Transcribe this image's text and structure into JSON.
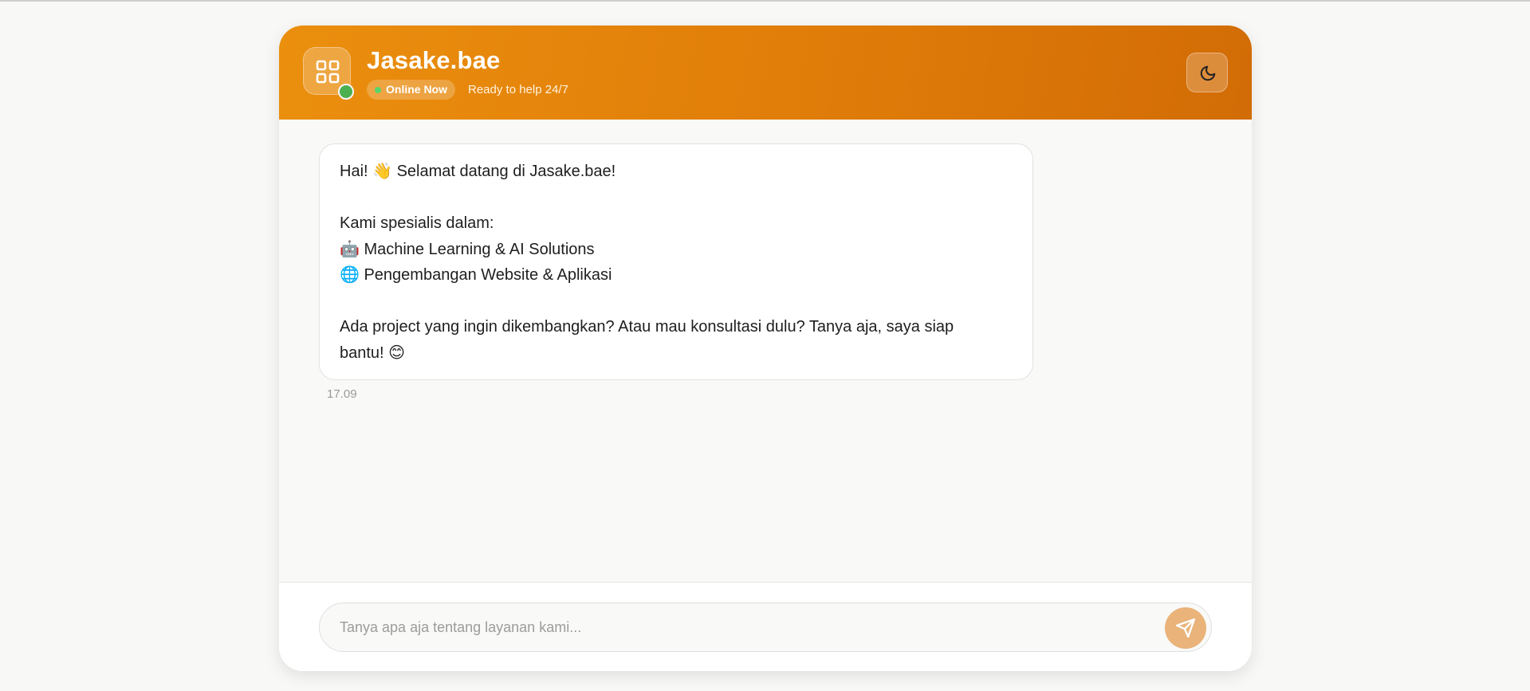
{
  "header": {
    "title": "Jasake.bae",
    "status_label": "Online Now",
    "status_subtext": "Ready to help 24/7",
    "logo_icon": "grid-icon",
    "theme_toggle_icon": "moon-icon"
  },
  "message": {
    "lines": [
      "Hai! 👋 Selamat datang di Jasake.bae!",
      "",
      "Kami spesialis dalam:",
      "🤖 Machine Learning & AI Solutions",
      "🌐 Pengembangan Website & Aplikasi",
      "",
      "Ada project yang ingin dikembangkan? Atau mau konsultasi dulu? Tanya aja, saya siap",
      "bantu! 😊"
    ],
    "timestamp": "17.09"
  },
  "composer": {
    "placeholder": "Tanya apa aja tentang layanan kami...",
    "value": "",
    "send_icon": "send-icon"
  },
  "colors": {
    "header_gradient_start": "#eb8f0e",
    "header_gradient_end": "#d26c06",
    "online_green": "#4caf50",
    "send_button": "#e9b37a"
  }
}
